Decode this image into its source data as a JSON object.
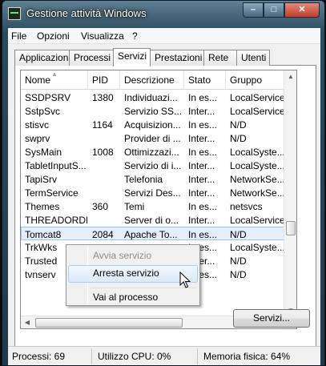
{
  "window": {
    "title": "Gestione attività Windows",
    "caption_minimize": "–",
    "caption_maximize": "□",
    "caption_close": "✕"
  },
  "menu": [
    "File",
    "Opzioni",
    "Visualizza",
    "?"
  ],
  "tabs": [
    {
      "label": "Applicazioni",
      "active": false
    },
    {
      "label": "Processi",
      "active": false
    },
    {
      "label": "Servizi",
      "active": true
    },
    {
      "label": "Prestazioni",
      "active": false
    },
    {
      "label": "Rete",
      "active": false
    },
    {
      "label": "Utenti",
      "active": false
    }
  ],
  "table": {
    "columns": [
      "Nome",
      "PID",
      "Descrizione",
      "Stato",
      "Gruppo"
    ],
    "sort_column": "Nome",
    "rows": [
      {
        "name": "SSDPSRV",
        "pid": "1380",
        "desc": "Individuazi...",
        "state": "In es...",
        "group": "LocalService..."
      },
      {
        "name": "SstpSvc",
        "pid": "",
        "desc": "Servizio SS...",
        "state": "Inter...",
        "group": "LocalService"
      },
      {
        "name": "stisvc",
        "pid": "1164",
        "desc": "Acquisizion...",
        "state": "In es...",
        "group": "N/D"
      },
      {
        "name": "swprv",
        "pid": "",
        "desc": "Provider di ...",
        "state": "Inter...",
        "group": "N/D"
      },
      {
        "name": "SysMain",
        "pid": "1008",
        "desc": "Ottimizzazi...",
        "state": "In es...",
        "group": "LocalSyste..."
      },
      {
        "name": "TabletInputS...",
        "pid": "",
        "desc": "Servizio di i...",
        "state": "Inter...",
        "group": "LocalSyste..."
      },
      {
        "name": "TapiSrv",
        "pid": "",
        "desc": "Telefonia",
        "state": "Inter...",
        "group": "NetworkSe..."
      },
      {
        "name": "TermService",
        "pid": "",
        "desc": "Servizi Des...",
        "state": "Inter...",
        "group": "NetworkSe..."
      },
      {
        "name": "Themes",
        "pid": "360",
        "desc": "Temi",
        "state": "In es...",
        "group": "netsvcs"
      },
      {
        "name": "THREADORDER",
        "pid": "",
        "desc": "Server di o...",
        "state": "Inter...",
        "group": "LocalService"
      },
      {
        "name": "Tomcat8",
        "pid": "2084",
        "desc": "Apache To...",
        "state": "In es...",
        "group": "N/D",
        "selected": true
      },
      {
        "name": "TrkWks",
        "pid": "",
        "desc": "",
        "state": "In es...",
        "group": "LocalSyste..."
      },
      {
        "name": "Trusted",
        "pid": "",
        "desc": "",
        "state": "Inter...",
        "group": "N/D"
      },
      {
        "name": "tvnserv",
        "pid": "",
        "desc": "",
        "state": "In es...",
        "group": "N/D"
      }
    ]
  },
  "context_menu": [
    {
      "label": "Avvia servizio",
      "disabled": true
    },
    {
      "label": "Arresta servizio",
      "disabled": false
    },
    {
      "label": "Vai al processo",
      "disabled": false
    }
  ],
  "services_button": "Servizi...",
  "status": {
    "processes": "Processi: 69",
    "cpu": "Utilizzo CPU: 0%",
    "memory": "Memoria fisica: 64%"
  }
}
